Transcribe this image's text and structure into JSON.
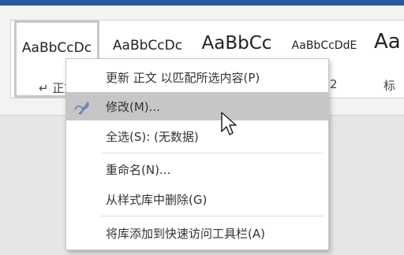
{
  "ribbon": {
    "styles": [
      {
        "preview": "AaBbCcDc",
        "name": "↵ 正文",
        "selected": true
      },
      {
        "preview": "AaBbCcDc",
        "name": ""
      },
      {
        "preview": "AaBbCc",
        "name": ""
      },
      {
        "preview": "AaBbCcDdE",
        "name": "2"
      },
      {
        "preview": "Aa",
        "name": "标"
      }
    ]
  },
  "menu": {
    "items": [
      {
        "label": "更新 正文 以匹配所选内容(P)"
      },
      {
        "label": "修改(M)...",
        "icon": "modify-style-icon",
        "hover": true
      },
      {
        "label": "全选(S): (无数据)"
      },
      {
        "label": "重命名(N)..."
      },
      {
        "label": "从样式库中删除(G)"
      },
      {
        "label": "将库添加到快速访问工具栏(A)"
      }
    ]
  },
  "colors": {
    "accent": "#2b579a",
    "hover": "#c6c6c6",
    "icon": "#5b7fbf"
  }
}
